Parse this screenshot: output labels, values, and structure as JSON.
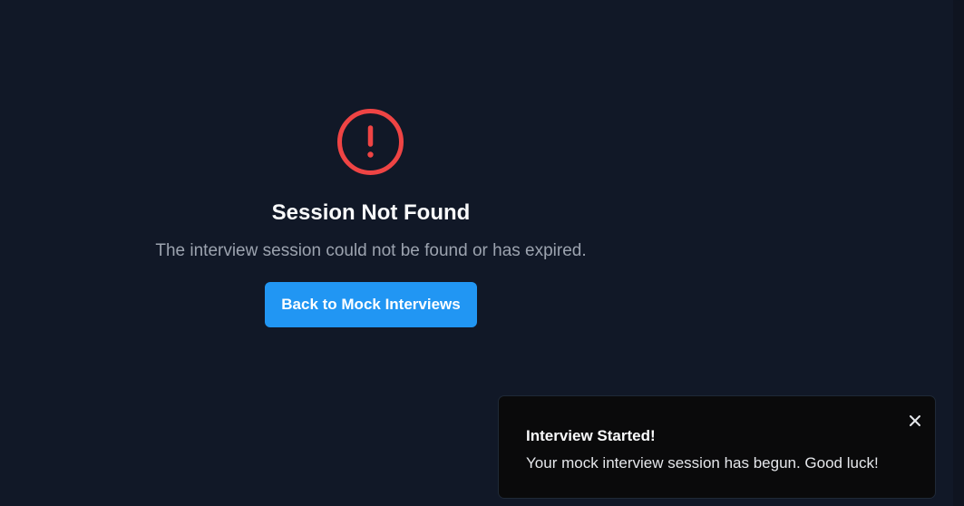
{
  "error": {
    "icon": "alert-circle-icon",
    "title": "Session Not Found",
    "message": "The interview session could not be found or has expired.",
    "button_label": "Back to Mock Interviews"
  },
  "toast": {
    "title": "Interview Started!",
    "message": "Your mock interview session has begun. Good luck!",
    "close_icon": "close-icon"
  },
  "colors": {
    "background": "#111827",
    "error_icon": "#ef4444",
    "primary_button": "#2196f3",
    "toast_background": "#0a0a0b"
  }
}
